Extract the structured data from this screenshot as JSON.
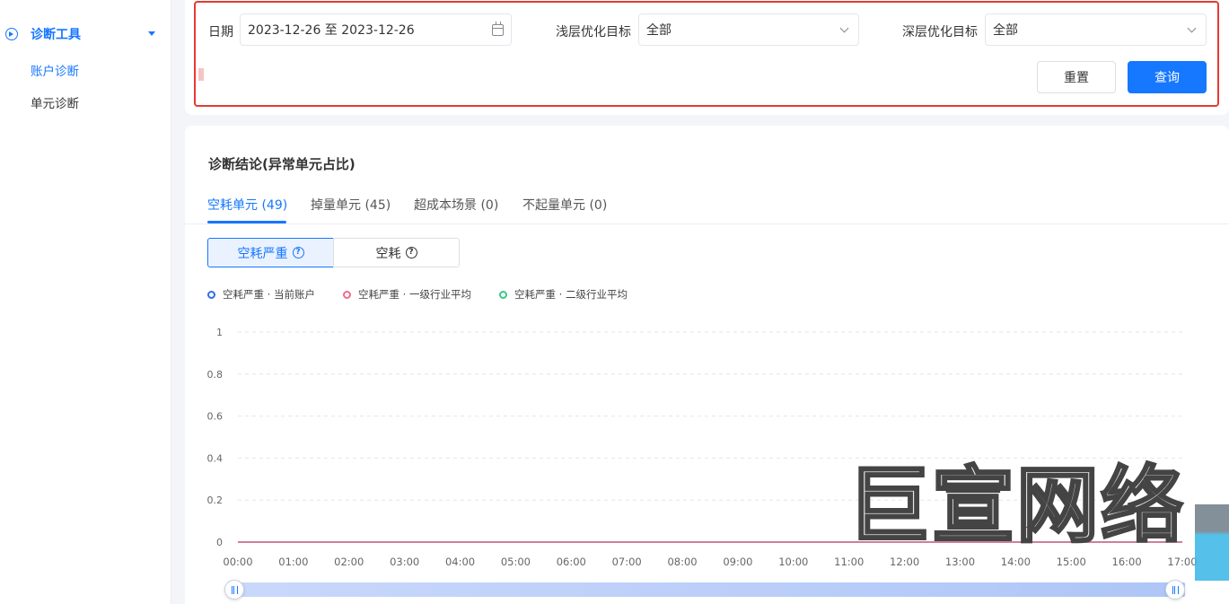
{
  "sidebar": {
    "group_label": "诊断工具",
    "items": [
      {
        "label": "账户诊断"
      },
      {
        "label": "单元诊断"
      }
    ]
  },
  "filters": {
    "date_label": "日期",
    "date_value": "2023-12-26 至 2023-12-26",
    "shallow_label": "浅层优化目标",
    "shallow_value": "全部",
    "deep_label": "深层优化目标",
    "deep_value": "全部",
    "reset_label": "重置",
    "query_label": "查询"
  },
  "main": {
    "title": "诊断结论(异常单元占比)",
    "tabs": [
      {
        "label": "空耗单元 (49)"
      },
      {
        "label": "掉量单元 (45)"
      },
      {
        "label": "超成本场景 (0)"
      },
      {
        "label": "不起量单元 (0)"
      }
    ],
    "segments": [
      {
        "label": "空耗严重"
      },
      {
        "label": "空耗"
      }
    ]
  },
  "colors": {
    "accent": "#1677ff",
    "series_current": "#2f6fe4",
    "series_level1": "#f06b8c",
    "series_level2": "#36c98b",
    "highlight_border": "#e53a32"
  },
  "watermark": {
    "text": "巨宣网络"
  },
  "chart_data": {
    "type": "line",
    "title": "",
    "xlabel": "",
    "ylabel": "",
    "x": [
      "00:00",
      "01:00",
      "02:00",
      "03:00",
      "04:00",
      "05:00",
      "06:00",
      "07:00",
      "08:00",
      "09:00",
      "10:00",
      "11:00",
      "12:00",
      "13:00",
      "14:00",
      "15:00",
      "16:00",
      "17:00"
    ],
    "ylim": [
      0,
      1
    ],
    "yticks": [
      "0",
      "0.2",
      "0.4",
      "0.6",
      "0.8",
      "1"
    ],
    "grid": true,
    "legend_position": "top-left",
    "series": [
      {
        "name": "空耗严重 · 当前账户",
        "color": "#2f6fe4",
        "values": [
          0,
          0,
          0,
          0,
          0,
          0,
          0,
          0,
          0,
          0,
          0,
          0,
          0,
          0,
          0,
          0,
          0,
          0
        ]
      },
      {
        "name": "空耗严重 · 一级行业平均",
        "color": "#f06b8c",
        "values": [
          0,
          0,
          0,
          0,
          0,
          0,
          0,
          0,
          0,
          0,
          0,
          0,
          0,
          0,
          0,
          0,
          0,
          0
        ]
      },
      {
        "name": "空耗严重 · 二级行业平均",
        "color": "#36c98b",
        "values": [
          0,
          0,
          0,
          0,
          0,
          0,
          0,
          0,
          0,
          0,
          0,
          0,
          0,
          0,
          0,
          0,
          0,
          0
        ]
      }
    ]
  }
}
